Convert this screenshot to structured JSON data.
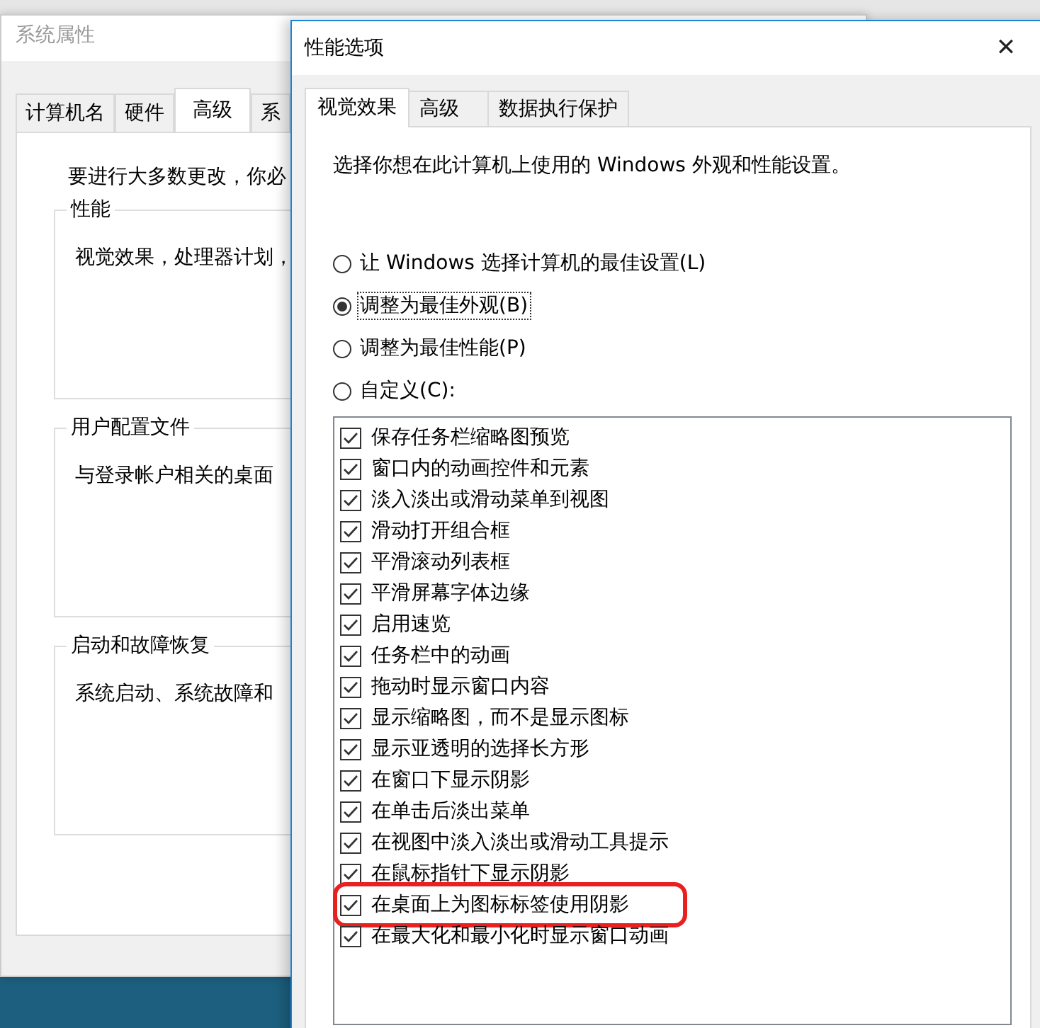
{
  "back_window": {
    "title": "系统属性",
    "tabs": [
      {
        "label": "计算机名",
        "selected": false
      },
      {
        "label": "硬件",
        "selected": false
      },
      {
        "label": "高级",
        "selected": true
      },
      {
        "label": "系",
        "selected": false
      }
    ],
    "intro": "要进行大多数更改，你必",
    "groups": [
      {
        "title": "性能",
        "text": "视觉效果，处理器计划，"
      },
      {
        "title": "用户配置文件",
        "text": "与登录帐户相关的桌面"
      },
      {
        "title": "启动和故障恢复",
        "text": "系统启动、系统故障和"
      }
    ]
  },
  "window": {
    "title": "性能选项",
    "close": "✕"
  },
  "tabs": [
    {
      "label": "视觉效果",
      "selected": true
    },
    {
      "label": "高级",
      "selected": false
    },
    {
      "label": "数据执行保护",
      "selected": false
    }
  ],
  "description": "选择你想在此计算机上使用的 Windows 外观和性能设置。",
  "options": [
    {
      "label": "让 Windows 选择计算机的最佳设置(L)",
      "selected": false
    },
    {
      "label": "调整为最佳外观(B)",
      "selected": true
    },
    {
      "label": "调整为最佳性能(P)",
      "selected": false
    },
    {
      "label": "自定义(C):",
      "selected": false
    }
  ],
  "effects": [
    {
      "label": "保存任务栏缩略图预览",
      "checked": true,
      "highlighted": false
    },
    {
      "label": "窗口内的动画控件和元素",
      "checked": true,
      "highlighted": false
    },
    {
      "label": "淡入淡出或滑动菜单到视图",
      "checked": true,
      "highlighted": false
    },
    {
      "label": "滑动打开组合框",
      "checked": true,
      "highlighted": false
    },
    {
      "label": "平滑滚动列表框",
      "checked": true,
      "highlighted": false
    },
    {
      "label": "平滑屏幕字体边缘",
      "checked": true,
      "highlighted": false
    },
    {
      "label": "启用速览",
      "checked": true,
      "highlighted": false
    },
    {
      "label": "任务栏中的动画",
      "checked": true,
      "highlighted": false
    },
    {
      "label": "拖动时显示窗口内容",
      "checked": true,
      "highlighted": false
    },
    {
      "label": "显示缩略图，而不是显示图标",
      "checked": true,
      "highlighted": false
    },
    {
      "label": "显示亚透明的选择长方形",
      "checked": true,
      "highlighted": false
    },
    {
      "label": "在窗口下显示阴影",
      "checked": true,
      "highlighted": false
    },
    {
      "label": "在单击后淡出菜单",
      "checked": true,
      "highlighted": false
    },
    {
      "label": "在视图中淡入淡出或滑动工具提示",
      "checked": true,
      "highlighted": false
    },
    {
      "label": "在鼠标指针下显示阴影",
      "checked": true,
      "highlighted": false
    },
    {
      "label": "在桌面上为图标标签使用阴影",
      "checked": true,
      "highlighted": true
    },
    {
      "label": "在最大化和最小化时显示窗口动画",
      "checked": true,
      "highlighted": false
    }
  ]
}
